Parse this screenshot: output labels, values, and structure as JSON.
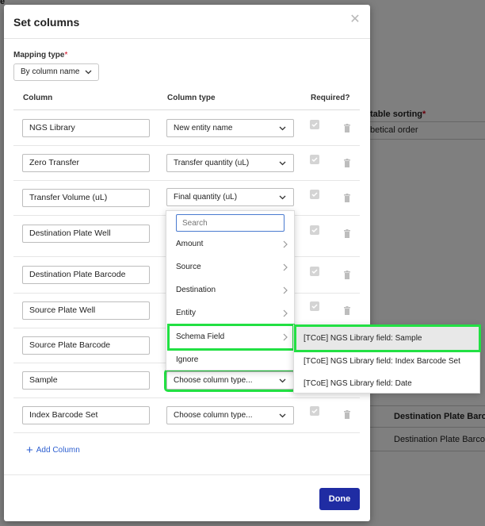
{
  "background": {
    "fragments": [
      "e",
      "table sorting",
      "betical order",
      "Destination Plate Barcod",
      "Destination Plate Barcode"
    ]
  },
  "modal": {
    "title": "Set columns",
    "close_icon": "close-icon",
    "mapping_type_label": "Mapping type",
    "mapping_type_required": "*",
    "mapping_type_value": "By column name",
    "headers": {
      "column": "Column",
      "column_type": "Column type",
      "required": "Required?"
    },
    "rows": [
      {
        "name": "NGS Library",
        "type": "New entity name"
      },
      {
        "name": "Zero Transfer",
        "type": "Transfer quantity (uL)"
      },
      {
        "name": "Transfer Volume (uL)",
        "type": "Final quantity (uL)"
      },
      {
        "name": "Destination Plate Well",
        "type": ""
      },
      {
        "name": "Destination Plate Barcode",
        "type": ""
      },
      {
        "name": "Source Plate Well",
        "type": ""
      },
      {
        "name": "Source Plate Barcode",
        "type": ""
      },
      {
        "name": "Sample",
        "type": "Choose column type..."
      },
      {
        "name": "Index Barcode Set",
        "type": "Choose column type..."
      }
    ],
    "add_column_label": "Add Column",
    "done_label": "Done"
  },
  "dropdown": {
    "search_placeholder": "Search",
    "items": [
      "Amount",
      "Source",
      "Destination",
      "Entity",
      "Schema Field",
      "Ignore"
    ]
  },
  "submenu": {
    "items": [
      "[TCoE] NGS Library field: Sample",
      "[TCoE] NGS Library field: Index Barcode Set",
      "[TCoE] NGS Library field: Date"
    ]
  },
  "colors": {
    "highlight": "#22e043",
    "primary_button": "#1f2ca3",
    "link": "#2d5fd0"
  }
}
